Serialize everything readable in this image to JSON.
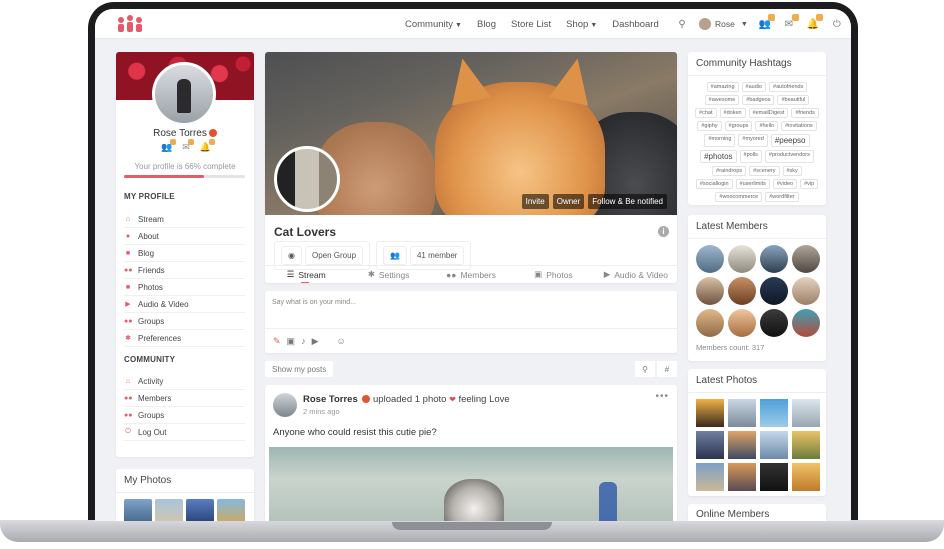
{
  "nav": {
    "links": [
      {
        "label": "Community",
        "dropdown": true
      },
      {
        "label": "Blog",
        "dropdown": false
      },
      {
        "label": "Store List",
        "dropdown": false
      },
      {
        "label": "Shop",
        "dropdown": true
      },
      {
        "label": "Dashboard",
        "dropdown": false
      }
    ],
    "user_name": "Rose"
  },
  "profile": {
    "name": "Rose Torres",
    "completion_text": "Your profile is 66% complete",
    "completion": 0.66,
    "my_profile_title": "MY PROFILE",
    "my_profile_items": [
      "Stream",
      "About",
      "Blog",
      "Friends",
      "Photos",
      "Audio & Video",
      "Groups",
      "Preferences"
    ],
    "community_title": "COMMUNITY",
    "community_items": [
      "Activity",
      "Members",
      "Groups",
      "Log Out"
    ],
    "my_photos_title": "My Photos"
  },
  "group": {
    "title": "Cat Lovers",
    "privacy": "Open Group",
    "members": "41 member",
    "cover_actions": [
      "Invite",
      "Owner",
      "Follow & Be notified"
    ],
    "tabs": [
      "Stream",
      "Settings",
      "Members",
      "Photos",
      "Audio & Video"
    ],
    "info_glyph": "i"
  },
  "composer": {
    "placeholder": "Say what is on your mind..."
  },
  "filter": {
    "show_posts": "Show my posts"
  },
  "post": {
    "author": "Rose Torres",
    "action": "uploaded 1 photo",
    "feeling": "feeling Love",
    "time": "2 mins ago",
    "text": "Anyone who could resist this cutie pie?",
    "more": "•••"
  },
  "sidebar_right": {
    "hashtags_title": "Community Hashtags",
    "hashtags": [
      "#amazing",
      "#audio",
      "#autofriends",
      "#awesome",
      "#badgeos",
      "#beautiful",
      "#chat",
      "#doken",
      "#emailDigest",
      "#friends",
      "#giphy",
      "#groups",
      "#hello",
      "#invitations",
      "#morning",
      "#myored",
      "#peepso",
      "#photos",
      "#polls",
      "#productvendors",
      "#raindrops",
      "#scenery",
      "#sky",
      "#sociallogin",
      "#userlimits",
      "#video",
      "#vip",
      "#woocommerce",
      "#wordfilter"
    ],
    "big_hashtags": [
      "#peepso",
      "#photos"
    ],
    "latest_members_title": "Latest Members",
    "members_count": "Members count: 317",
    "latest_photos_title": "Latest Photos",
    "online_members_title": "Online Members"
  },
  "colors": {
    "accent": "#e65a6b",
    "badge": "#f0ad4e",
    "verified": "#e8502e"
  }
}
